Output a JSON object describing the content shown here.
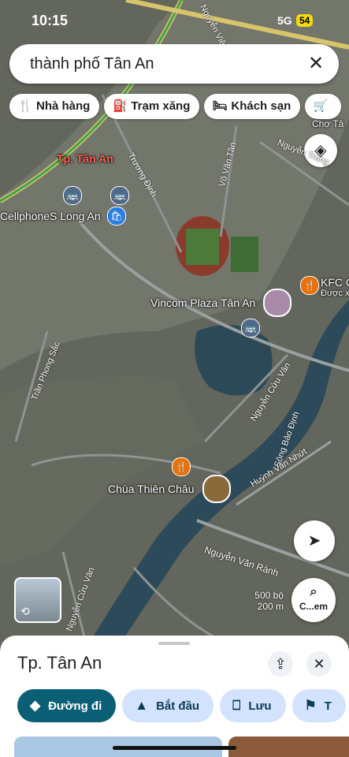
{
  "status": {
    "time": "10:15",
    "network": "5G",
    "battery": "54"
  },
  "search": {
    "query": "thành phố Tân An",
    "clear_icon": "close-icon"
  },
  "chips": [
    {
      "icon": "restaurant-icon",
      "label": "Nhà hàng"
    },
    {
      "icon": "gas-station-icon",
      "label": "Trạm xăng"
    },
    {
      "icon": "hotel-icon",
      "label": "Khách sạn"
    },
    {
      "icon": "cart-icon",
      "label": ""
    }
  ],
  "map": {
    "place_labels": {
      "city": "Tp. Tân An",
      "cellphones": "CellphoneS Long An",
      "vincom": "Vincom Plaza Tân An",
      "kfc": "KFC C",
      "kfc_sub": "Được x",
      "cho": "Chợ Tâ",
      "chua": "Chùa Thiên Châu"
    },
    "street_labels": {
      "truong_dinh": "Trương Định",
      "vo_van_tan": "Võ Văn Tần",
      "nguyen_trung": "Nguyễn Trung",
      "tran_phong_sac": "Trần Phong Sắc",
      "nguyen_cuu_van": "Nguyễn Cửu Vân",
      "song_bao_dinh": "Sông Bảo Định",
      "huynh_van_nhut": "Huỳnh Văn Nhứt",
      "nguyen_van_ranh": "Nguyễn Văn Rành",
      "nguyen_cuu_van_2": "Nguyễn Cửu Vân",
      "nguyen_viet_thanh": "Nguyễn Việt Thanh"
    },
    "scale": {
      "imperial": "500 bộ",
      "metric": "200 m"
    },
    "lens_label": "C...em"
  },
  "sheet": {
    "title": "Tp. Tân An",
    "actions": [
      {
        "icon": "directions-icon",
        "label": "Đường đi"
      },
      {
        "icon": "navigation-arrow-icon",
        "label": "Bắt đầu"
      },
      {
        "icon": "bookmark-icon",
        "label": "Lưu"
      },
      {
        "icon": "flag-icon",
        "label": "T"
      }
    ]
  }
}
